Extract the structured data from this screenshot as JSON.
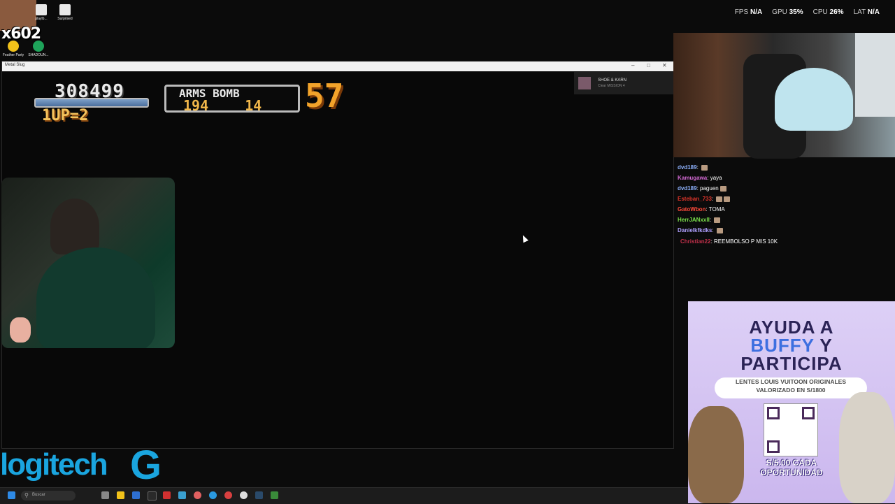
{
  "desktop": {
    "icons": [
      {
        "label": "playlb..."
      },
      {
        "label": "Surprised"
      },
      {
        "label": "Feather Party"
      },
      {
        "label": "SHADOUN..."
      }
    ],
    "combo_text": "x602"
  },
  "stats": {
    "fps_label": "FPS",
    "fps_value": "N/A",
    "gpu_label": "GPU",
    "gpu_value": "35%",
    "cpu_label": "CPU",
    "cpu_value": "26%",
    "lat_label": "LAT",
    "lat_value": "N/A"
  },
  "game": {
    "window_title": "Metal Slug",
    "score": "308499",
    "lives": "1UP=2",
    "arms_header": "ARMS BOMB",
    "arms": "194",
    "bomb": "14",
    "timer": "57",
    "achievement": {
      "title": "SHOE & KARN",
      "desc": "Clear MISSION 4"
    }
  },
  "chat": [
    {
      "user": "dvd189",
      "msg": "",
      "color": "#8fb3ff"
    },
    {
      "user": "Kamugawa",
      "msg": "yaya",
      "color": "#d46ad4"
    },
    {
      "user": "dvd189",
      "msg": "paguen",
      "color": "#8fb3ff"
    },
    {
      "user": "Esteban_733",
      "msg": "",
      "color": "#e0352b"
    },
    {
      "user": "GatoWbon",
      "msg": "TOMA",
      "color": "#ff4a3a"
    },
    {
      "user": "HerrJANxxII",
      "msg": "",
      "color": "#7adf4a"
    },
    {
      "user": "Danielkfkdks",
      "msg": "",
      "color": "#b0a0ff"
    },
    {
      "user": "Christian22",
      "msg": "REEMBOLSO P MIS 10K",
      "color": "#c0304a"
    }
  ],
  "promo": {
    "line1": "AYUDA A",
    "line2_blue": "BUFFY",
    "line2_rest": "Y",
    "line3": "PARTICIPA",
    "pill_line1": "LENTES LOUIS VUITOON ORIGINALES",
    "pill_line2": "VALORIZADO EN S/1800",
    "price_line1": "S/5.00 CADA",
    "price_line2": "OPORTUNIDAD"
  },
  "brand": {
    "logitech": "logitech",
    "g": "G"
  },
  "taskbar": {
    "search_placeholder": "Buscar"
  }
}
